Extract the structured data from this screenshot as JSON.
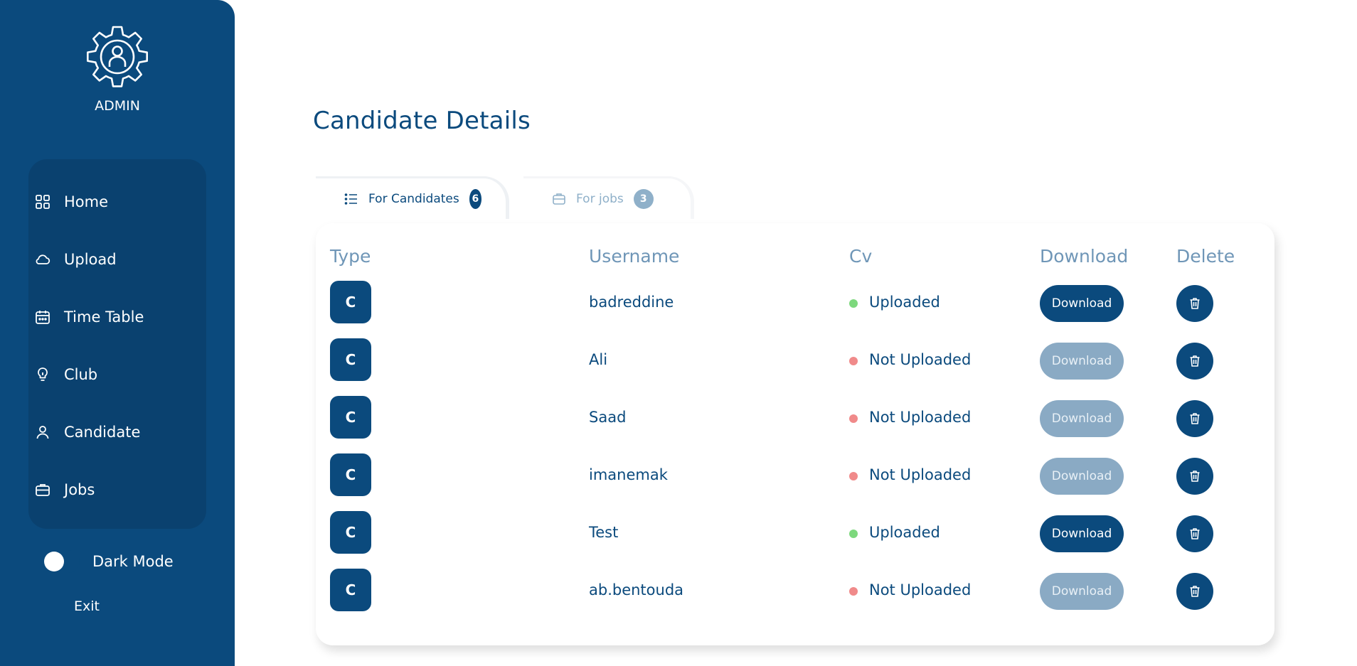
{
  "sidebar": {
    "role_label": "ADMIN",
    "items": [
      {
        "label": "Home",
        "icon": "grid-icon"
      },
      {
        "label": "Upload",
        "icon": "cloud-icon"
      },
      {
        "label": "Time Table",
        "icon": "calendar-icon"
      },
      {
        "label": "Club",
        "icon": "lightbulb-icon"
      },
      {
        "label": "Candidate",
        "icon": "user-icon"
      },
      {
        "label": "Jobs",
        "icon": "briefcase-icon"
      }
    ],
    "dark_mode_label": "Dark Mode",
    "dark_mode_on": false,
    "exit_label": "Exit"
  },
  "main": {
    "title": "Candidate Details",
    "tabs": [
      {
        "label": "For Candidates",
        "count": "6",
        "icon": "list-icon",
        "active": true
      },
      {
        "label": "For jobs",
        "count": "3",
        "icon": "briefcase-icon",
        "active": false
      }
    ],
    "columns": [
      "Type",
      "Username",
      "Cv",
      "Download",
      "Delete"
    ],
    "rows": [
      {
        "type": "C",
        "username": "badreddine",
        "cv": "Uploaded",
        "cv_uploaded": true,
        "download": "Download"
      },
      {
        "type": "C",
        "username": "Ali",
        "cv": "Not Uploaded",
        "cv_uploaded": false,
        "download": "Download"
      },
      {
        "type": "C",
        "username": "Saad",
        "cv": "Not Uploaded",
        "cv_uploaded": false,
        "download": "Download"
      },
      {
        "type": "C",
        "username": "imanemak",
        "cv": "Not Uploaded",
        "cv_uploaded": false,
        "download": "Download"
      },
      {
        "type": "C",
        "username": "Test",
        "cv": "Uploaded",
        "cv_uploaded": true,
        "download": "Download"
      },
      {
        "type": "C",
        "username": "ab.bentouda",
        "cv": "Not Uploaded",
        "cv_uploaded": false,
        "download": "Download"
      }
    ]
  },
  "colors": {
    "primary": "#0b4a7d",
    "sidebar_panel": "#0a416f",
    "muted": "#8aaac4",
    "uploaded_dot": "#7dd87d",
    "not_uploaded_dot": "#f08a8a"
  }
}
